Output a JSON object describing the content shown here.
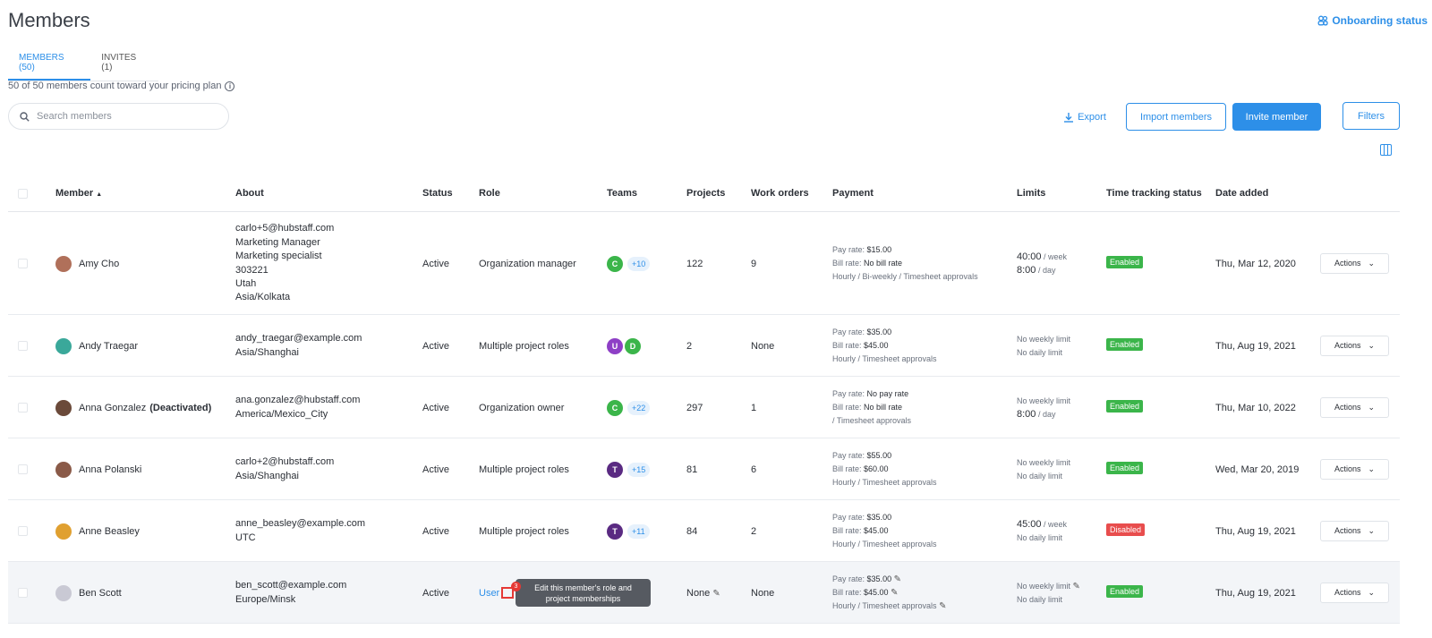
{
  "page": {
    "title": "Members",
    "onboarding_label": "Onboarding status"
  },
  "tabs": [
    {
      "label": "MEMBERS (50)"
    },
    {
      "label": "INVITES (1)"
    }
  ],
  "plan_note": "50 of 50 members count toward your pricing plan",
  "search": {
    "placeholder": "Search members"
  },
  "toolbar": {
    "export": "Export",
    "import": "Import members",
    "invite": "Invite member",
    "filters": "Filters"
  },
  "colors": {
    "accent": "#2d8fe8",
    "enabled": "#3bb54a",
    "disabled": "#e84d4d"
  },
  "headers": {
    "member": "Member",
    "about": "About",
    "status": "Status",
    "role": "Role",
    "teams": "Teams",
    "projects": "Projects",
    "work_orders": "Work orders",
    "payment": "Payment",
    "limits": "Limits",
    "tts": "Time tracking status",
    "date_added": "Date added"
  },
  "rows": [
    {
      "name": "Amy Cho",
      "deact": "",
      "about": [
        "carlo+5@hubstaff.com",
        "Marketing Manager",
        "Marketing specialist",
        "303221",
        "Utah",
        "Asia/Kolkata"
      ],
      "status": "Active",
      "role": "Organization manager",
      "teams": [
        "C"
      ],
      "team_colors": [
        "#3bb54a"
      ],
      "team_more": "+10",
      "projects": "122",
      "work_orders": "9",
      "pay_rate": "$15.00",
      "bill_rate": "No bill rate",
      "pay_tags": "Hourly / Bi-weekly / Timesheet approvals",
      "limit_week": "40:00",
      "limit_day": "8:00",
      "tts": "Enabled",
      "date": "Thu, Mar 12, 2020"
    },
    {
      "name": "Andy Traegar",
      "deact": "",
      "about": [
        "andy_traegar@example.com",
        "Asia/Shanghai"
      ],
      "status": "Active",
      "role": "Multiple project roles",
      "teams": [
        "U",
        "D"
      ],
      "team_colors": [
        "#8e3fc6",
        "#3bb54a"
      ],
      "team_more": "",
      "projects": "2",
      "work_orders": "None",
      "pay_rate": "$35.00",
      "bill_rate": "$45.00",
      "pay_tags": "Hourly / Timesheet approvals",
      "limit_week": "No weekly limit",
      "limit_day": "No daily limit",
      "tts": "Enabled",
      "date": "Thu, Aug 19, 2021"
    },
    {
      "name": "Anna Gonzalez",
      "deact": "(Deactivated)",
      "about": [
        "ana.gonzalez@hubstaff.com",
        "America/Mexico_City"
      ],
      "status": "Active",
      "role": "Organization owner",
      "teams": [
        "C"
      ],
      "team_colors": [
        "#3bb54a"
      ],
      "team_more": "+22",
      "projects": "297",
      "work_orders": "1",
      "pay_rate": "No pay rate",
      "bill_rate": "No bill rate",
      "pay_tags": " / Timesheet approvals",
      "limit_week": "No weekly limit",
      "limit_day": "8:00",
      "tts": "Enabled",
      "date": "Thu, Mar 10, 2022"
    },
    {
      "name": "Anna Polanski",
      "deact": "",
      "about": [
        "carlo+2@hubstaff.com",
        "Asia/Shanghai"
      ],
      "status": "Active",
      "role": "Multiple project roles",
      "teams": [
        "T"
      ],
      "team_colors": [
        "#5a2a82"
      ],
      "team_more": "+15",
      "projects": "81",
      "work_orders": "6",
      "pay_rate": "$55.00",
      "bill_rate": "$60.00",
      "pay_tags": "Hourly / Timesheet approvals",
      "limit_week": "No weekly limit",
      "limit_day": "No daily limit",
      "tts": "Enabled",
      "date": "Wed, Mar 20, 2019"
    },
    {
      "name": "Anne Beasley",
      "deact": "",
      "about": [
        "anne_beasley@example.com",
        "UTC"
      ],
      "status": "Active",
      "role": "Multiple project roles",
      "teams": [
        "T"
      ],
      "team_colors": [
        "#5a2a82"
      ],
      "team_more": "+11",
      "projects": "84",
      "work_orders": "2",
      "pay_rate": "$35.00",
      "bill_rate": "$45.00",
      "pay_tags": "Hourly / Timesheet approvals",
      "limit_week": "45:00",
      "limit_day": "No daily limit",
      "tts": "Disabled",
      "date": "Thu, Aug 19, 2021"
    },
    {
      "name": "Ben Scott",
      "deact": "",
      "about": [
        "ben_scott@example.com",
        "Europe/Minsk"
      ],
      "status": "Active",
      "role": "User",
      "teams": [],
      "team_colors": [],
      "team_more": "",
      "projects": "None",
      "work_orders": "None",
      "pay_rate": "$35.00",
      "bill_rate": "$45.00",
      "pay_tags": "Hourly / Timesheet approvals",
      "limit_week": "No weekly limit",
      "limit_day": "No daily limit",
      "tts": "Enabled",
      "date": "Thu, Aug 19, 2021"
    }
  ],
  "labels": {
    "pay_rate": "Pay rate:",
    "bill_rate": "Bill rate:",
    "per_week": "/ week",
    "per_day": "/ day",
    "actions": "Actions"
  },
  "tooltip": {
    "line1": "Edit this member's role and",
    "line2": "project memberships",
    "step": "3"
  }
}
